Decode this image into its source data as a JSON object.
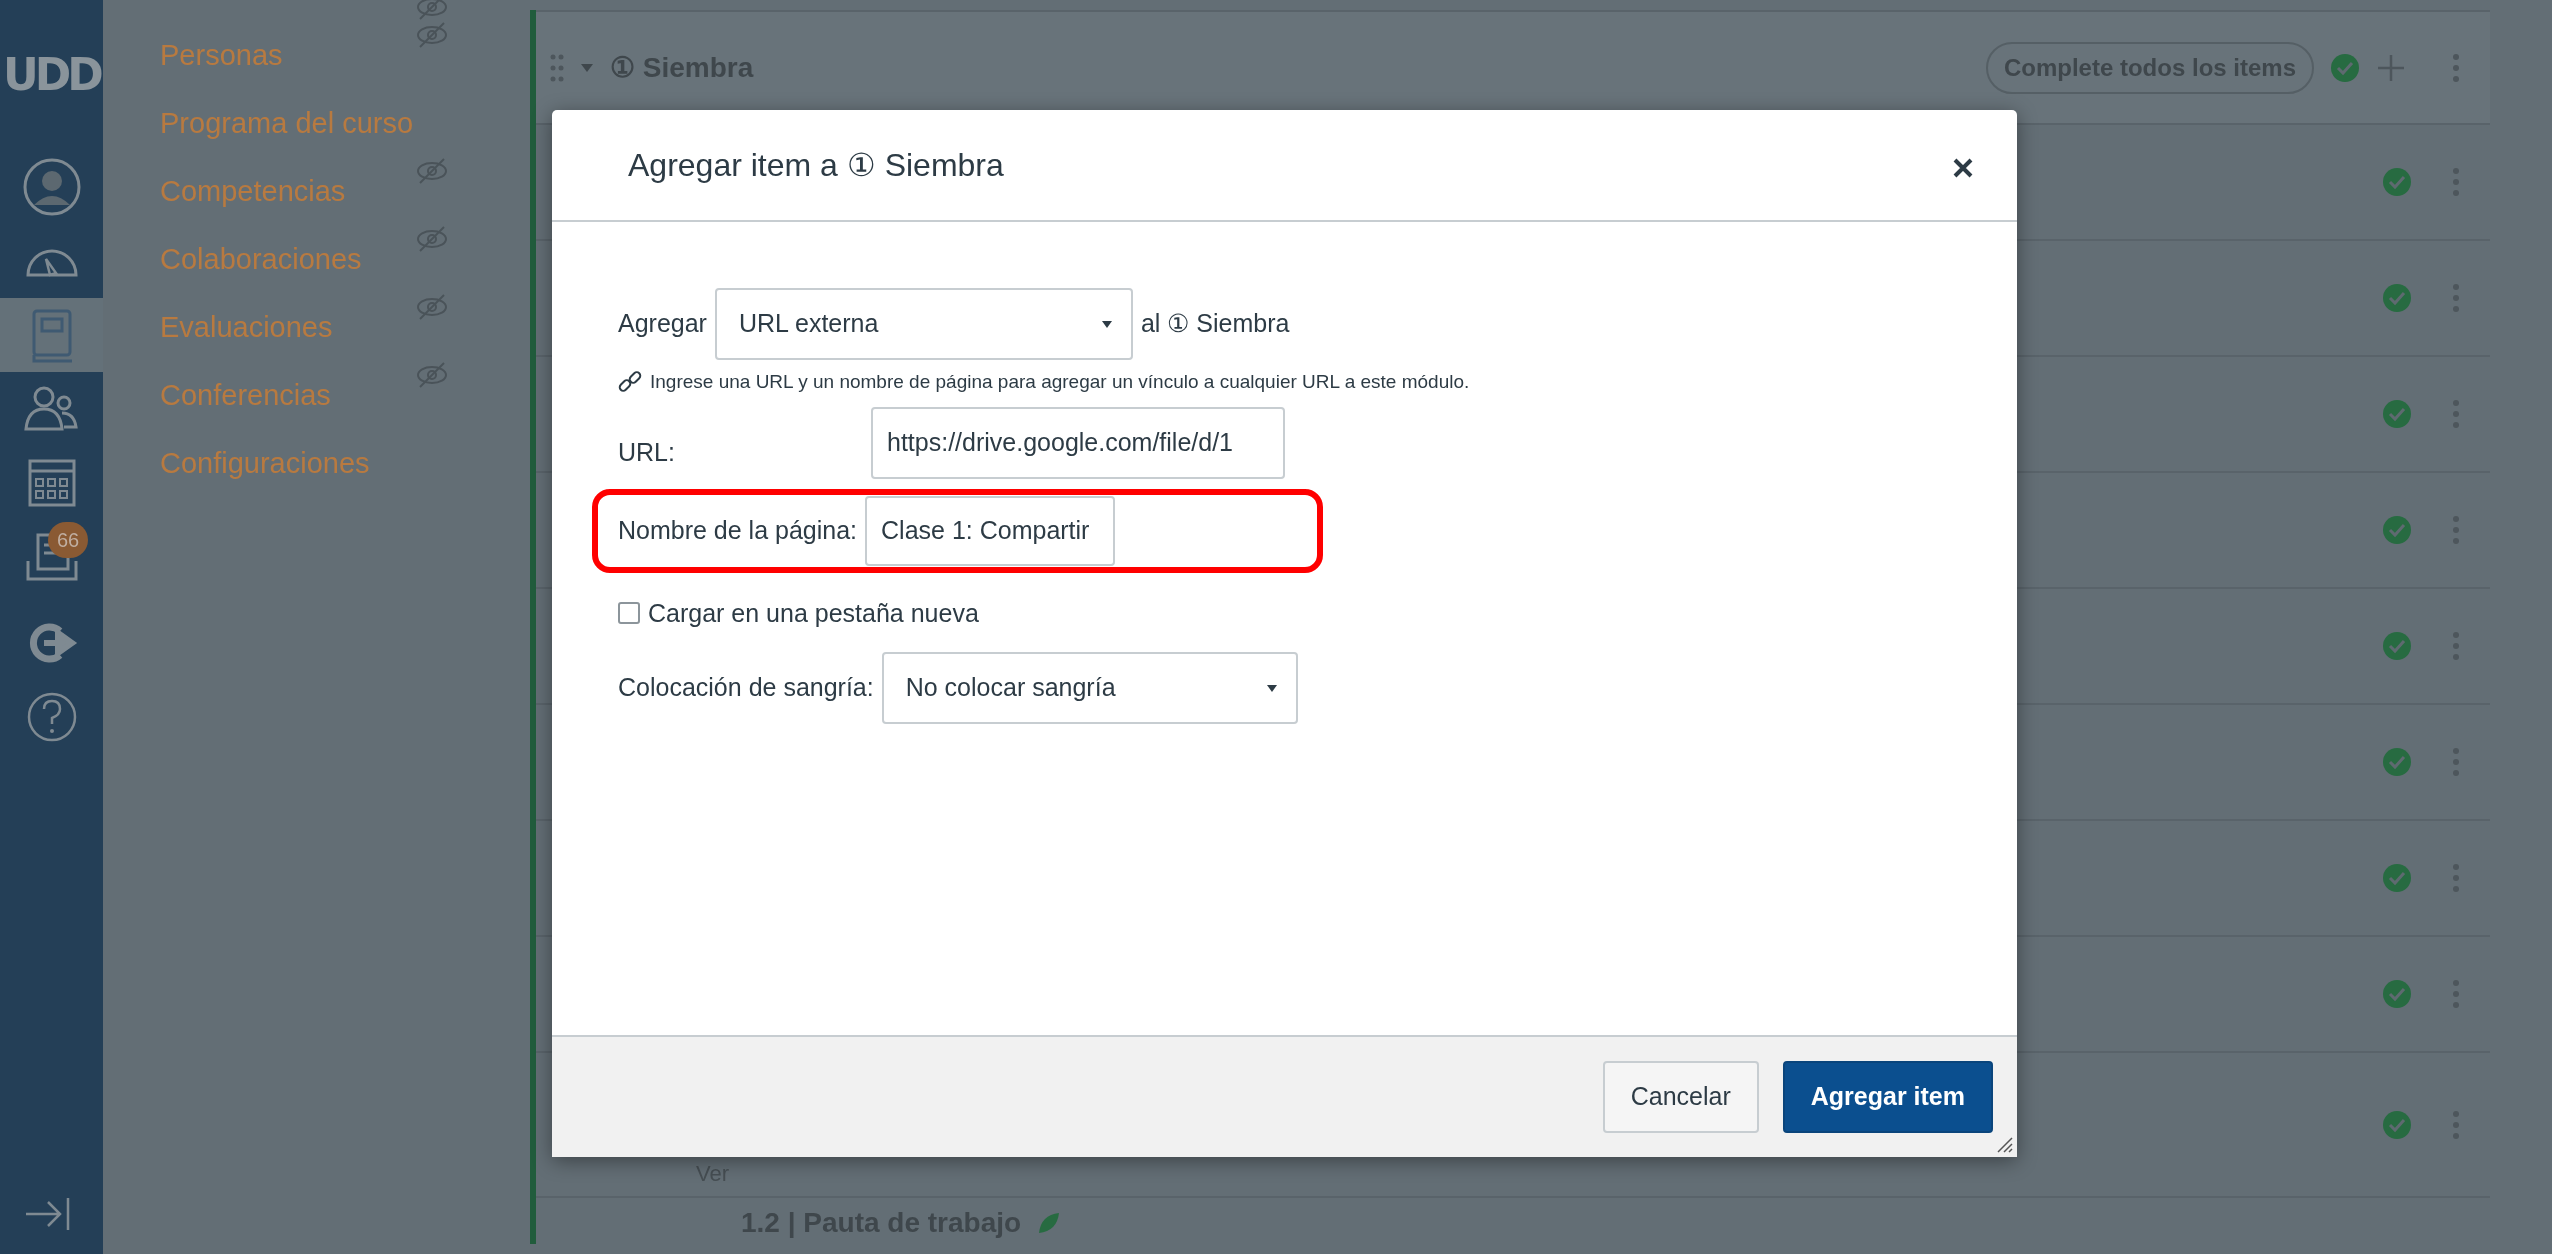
{
  "global_nav": {
    "logo": "UDD",
    "items": [
      {
        "selected": false
      },
      {
        "selected": false
      },
      {
        "selected": true
      },
      {
        "selected": false
      },
      {
        "selected": false
      },
      {
        "selected": false,
        "badge": "66"
      },
      {
        "selected": false
      },
      {
        "selected": false
      }
    ]
  },
  "course_nav": [
    {
      "label": "Personas",
      "hidden": true
    },
    {
      "label": "Programa del curso",
      "hidden": false
    },
    {
      "label": "Competencias",
      "hidden": true
    },
    {
      "label": "Colaboraciones",
      "hidden": true
    },
    {
      "label": "Evaluaciones",
      "hidden": true
    },
    {
      "label": "Conferencias",
      "hidden": true
    },
    {
      "label": "Configuraciones",
      "hidden": false
    }
  ],
  "module": {
    "title": "① Siembra",
    "expanded": true,
    "requirement": "Complete todos los items",
    "completed": true,
    "items": [
      {
        "completed": true
      },
      {
        "completed": true
      },
      {
        "completed": true
      },
      {
        "completed": true
      },
      {
        "completed": true
      },
      {
        "completed": true
      },
      {
        "completed": true
      },
      {
        "completed": true
      },
      {
        "completed": true,
        "subtitle": "Ver"
      }
    ],
    "next_item": "1.2 | Pauta de trabajo"
  },
  "dialog": {
    "title": "Agregar item a ① Siembra",
    "add_label": "Agregar",
    "item_type": "URL externa",
    "target": "al ① Siembra",
    "hint": "Ingrese una URL y un nombre de página para agregar un vínculo a cualquier URL a este módulo.",
    "url_label": "URL:",
    "url_value": "https://drive.google.com/file/d/1",
    "name_label": "Nombre de la página:",
    "name_value": "Clase 1: Compartir",
    "name_highlighted": true,
    "new_tab_label": "Cargar en una pestaña nueva",
    "new_tab_checked": false,
    "indent_label": "Colocación de sangría:",
    "indent_value": "No colocar sangría",
    "buttons": [
      {
        "kind": "cancel",
        "label": "Cancelar"
      },
      {
        "kind": "submit",
        "label": "Agregar item"
      }
    ]
  }
}
